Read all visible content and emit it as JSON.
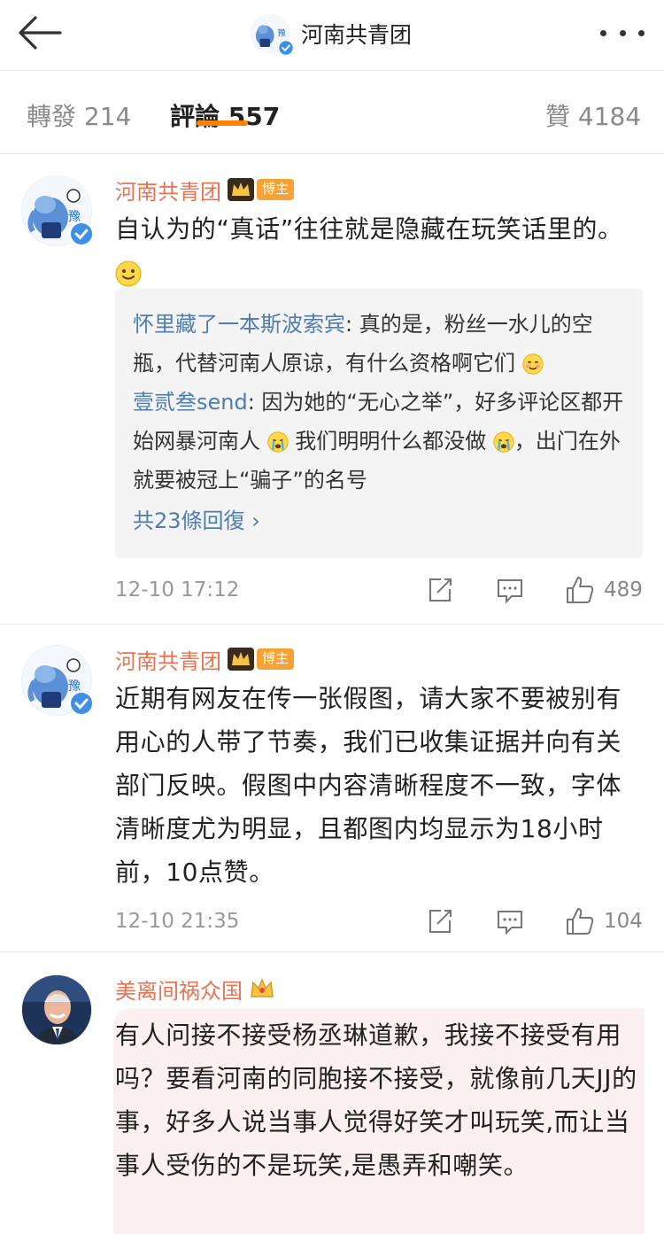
{
  "header": {
    "title": "河南共青团",
    "icons": {
      "back": "back-arrow-icon",
      "more": "more-dots-icon",
      "verified": "verified-badge-icon"
    }
  },
  "tabs": {
    "repost": "轉發 214",
    "comments": "評論 557",
    "likes": "贊 4184",
    "accent": "#ff8200"
  },
  "comments": [
    {
      "author": "河南共青团",
      "badge": "博主",
      "text": "自认为的“真话”往往就是隐藏在玩笑话里的。",
      "emoji": "smile-emoji",
      "replies": [
        {
          "name": "怀里藏了一本斯波索宾",
          "text": ": 真的是，粉丝一水儿的空瓶，代替河南人原谅，有什么资格啊它们"
        },
        {
          "name": "壹贰叁send",
          "text": ": 因为她的“无心之举”，好多评论区都开始网暴河南人",
          "text2": " 我们明明什么都没做",
          "text3": "，出门在外就要被冠上“骗子”的名号"
        }
      ],
      "more_replies": "共23條回復 ›",
      "time": "12-10 17:12",
      "likes": "489"
    },
    {
      "author": "河南共青团",
      "badge": "博主",
      "text": "近期有网友在传一张假图，请大家不要被别有用心的人带了节奏，我们已收集证据并向有关部门反映。假图中内容清晰程度不一致，字体清晰度尤为明显，且都图内均显示为18小时前，10点赞。",
      "time": "12-10 21:35",
      "likes": "104"
    },
    {
      "author": "美离间祸众国",
      "text": "有人问接不接受杨丞琳道歉，我接不接受有用吗？要看河南的同胞接不接受，就像前几天JJ的事，好多人说当事人觉得好笑才叫玩笑,而让当事人受伤的不是玩笑,是愚弄和嘲笑。"
    }
  ],
  "colors": {
    "author": "#eb7350",
    "link": "#507daf",
    "badge": "#f7a234"
  }
}
